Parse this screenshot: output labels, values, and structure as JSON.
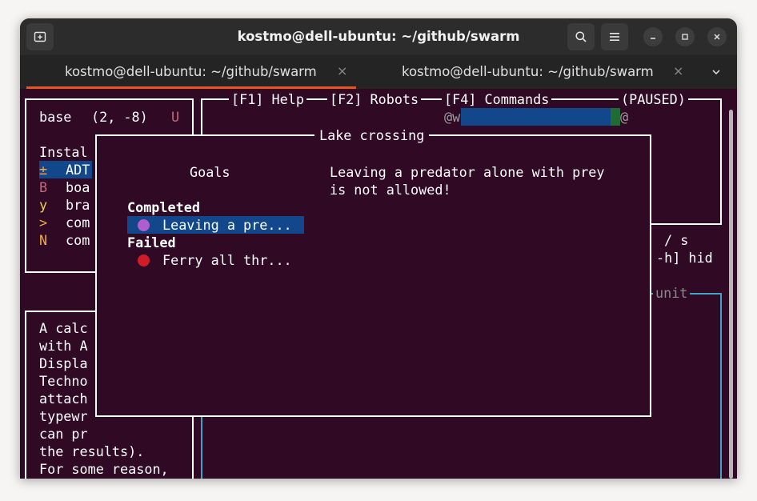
{
  "window": {
    "title": "kostmo@dell-ubuntu: ~/github/swarm"
  },
  "tabs": [
    {
      "label": "kostmo@dell-ubuntu: ~/github/swarm",
      "close": "×",
      "active": true
    },
    {
      "label": "kostmo@dell-ubuntu: ~/github/swarm",
      "close": "×",
      "active": false
    }
  ],
  "menu": {
    "f1": "[F1] Help",
    "f2": "[F2] Robots",
    "f4": "[F4] Commands",
    "paused": "(PAUSED)"
  },
  "robot_panel": {
    "name": "base",
    "coords": "(2, -8)",
    "flag": "U",
    "install_label": "Instal",
    "items": [
      {
        "glyph": "±",
        "label": "ADT",
        "selected": true
      },
      {
        "glyph": "B",
        "label": "boa"
      },
      {
        "glyph": "y",
        "label": "bra"
      },
      {
        "glyph": ">",
        "label": "com"
      },
      {
        "glyph": "N",
        "label": "com"
      }
    ]
  },
  "world": {
    "robot_a": "@w",
    "robot_b": "@"
  },
  "right_panel": {
    "slash_s": "/ s",
    "hide_hint": "-h] hid",
    "unit_label": "unit"
  },
  "description": {
    "lines": [
      "A calc",
      "with A",
      "Displa",
      "Techno",
      "attach",
      "typewr",
      "can pr",
      "the results).",
      "For some reason,"
    ],
    "more": ". . ."
  },
  "modal": {
    "title": "Lake crossing",
    "goals_header": "Goals",
    "completed_header": "Completed",
    "completed_items": [
      {
        "label": "Leaving a pre...",
        "dot_color": "#b15dd0"
      }
    ],
    "failed_header": "Failed",
    "failed_items": [
      {
        "label": "Ferry all thr...",
        "dot_color": "#d01c28"
      }
    ],
    "detail_line1": "Leaving a predator alone with prey",
    "detail_line2": "is not allowed!"
  },
  "colors": {
    "background": "#300a24",
    "selection": "#12488b",
    "accent": "#e95420",
    "info_border": "#3ea3c7"
  }
}
